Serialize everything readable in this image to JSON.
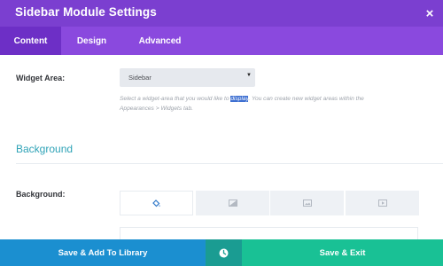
{
  "header": {
    "title": "Sidebar Module Settings",
    "close_glyph": "×"
  },
  "tabs": [
    {
      "label": "Content",
      "active": true
    },
    {
      "label": "Design",
      "active": false
    },
    {
      "label": "Advanced",
      "active": false
    }
  ],
  "widget_area": {
    "label": "Widget Area:",
    "selected": "Sidebar",
    "help_before": "Select a widget-area that you would like to ",
    "help_highlight": "display",
    "help_after": ". You can create new widget areas within the Appearances > Widgets tab."
  },
  "background_section": {
    "title": "Background",
    "label": "Background:",
    "tabs": [
      {
        "icon": "paint-bucket-icon",
        "active": true
      },
      {
        "icon": "gradient-icon",
        "active": false
      },
      {
        "icon": "image-icon",
        "active": false
      },
      {
        "icon": "video-icon",
        "active": false
      }
    ]
  },
  "footer": {
    "library_label": "Save & Add To Library",
    "history_icon": "history-icon",
    "exit_label": "Save & Exit"
  },
  "colors": {
    "header": "#7b3fd0",
    "tabs_bar": "#8a49de",
    "active_tab": "#6d2fc6",
    "section_title": "#2fa3b7",
    "library_button": "#1b8fd0",
    "history_button": "#1a9c92",
    "exit_button": "#19c195"
  }
}
